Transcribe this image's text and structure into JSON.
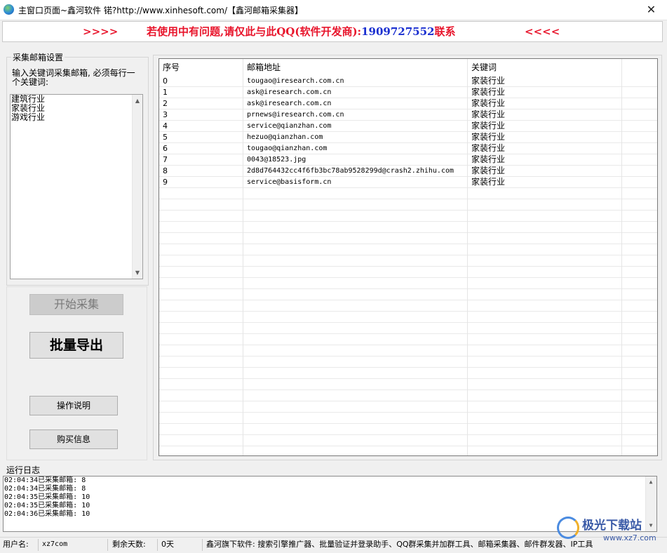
{
  "window": {
    "title": "主窗口页面~鑫河软件 锘?http://www.xinhesoft.com/【鑫河邮箱采集器】",
    "close_glyph": "✕"
  },
  "banner": {
    "arrows_left": ">>>>",
    "msg_prefix": "若使用中有问题,请仅此与此QQ(软件开发商):",
    "qq": "1909727552",
    "msg_suffix": "联系",
    "arrows_right": "<<<<",
    "colors": {
      "red": "#e8142b",
      "blue": "#1a2fd0"
    }
  },
  "keyword_settings": {
    "group_title": "采集邮箱设置",
    "instruction": "输入关键词采集邮箱, 必须每行一个关键词:",
    "keywords": [
      "建筑行业",
      "家装行业",
      "游戏行业"
    ]
  },
  "buttons": {
    "start": "开始采集",
    "export": "批量导出",
    "help": "操作说明",
    "buy": "购买信息"
  },
  "table": {
    "columns": [
      "序号",
      "邮箱地址",
      "关键词"
    ],
    "rows": [
      [
        "0",
        "tougao@iresearch.com.cn",
        "家装行业"
      ],
      [
        "1",
        "ask@iresearch.com.cn",
        "家装行业"
      ],
      [
        "2",
        "ask@iresearch.com.cn",
        "家装行业"
      ],
      [
        "3",
        "prnews@iresearch.com.cn",
        "家装行业"
      ],
      [
        "4",
        "service@qianzhan.com",
        "家装行业"
      ],
      [
        "5",
        "hezuo@qianzhan.com",
        "家装行业"
      ],
      [
        "6",
        "tougao@qianzhan.com",
        "家装行业"
      ],
      [
        "7",
        "0043@18523.jpg",
        "家装行业"
      ],
      [
        "8",
        "2d8d764432cc4f6fb3bc78ab9528299d@crash2.zhihu.com",
        "家装行业"
      ],
      [
        "9",
        "service@basisform.cn",
        "家装行业"
      ]
    ]
  },
  "log": {
    "label": "运行日志",
    "lines": [
      "02:04:34已采集邮箱: 8",
      "02:04:34已采集邮箱: 8",
      "02:04:35已采集邮箱: 10",
      "02:04:35已采集邮箱: 10",
      "02:04:36已采集邮箱: 10"
    ]
  },
  "status_bar": {
    "user_label": "用户名:",
    "user_value": "xz7com",
    "days_label": "剩余天数:",
    "days_value": "0天",
    "promo": "鑫河旗下软件: 搜索引擎推广器、批量验证并登录助手、QQ群采集并加群工具、邮箱采集器、邮件群发器、IP工具"
  },
  "watermark": {
    "text": "极光下载站",
    "url": "www.xz7.com"
  }
}
